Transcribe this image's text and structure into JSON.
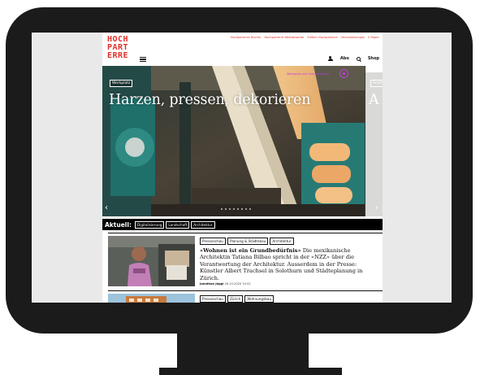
{
  "brand": {
    "logo_lines": [
      "HOCH",
      "PART",
      "ERRE"
    ],
    "accent": "#e3322c"
  },
  "topnav": [
    "Hochparterre Bücher",
    "Hochparterre Wettbewerbe",
    "Edition Hochparterre",
    "Veranstaltungen",
    "E-Paper"
  ],
  "utilnav": {
    "abo": "Abo",
    "shop": "Shop"
  },
  "hero": {
    "tag": "Werkplatz",
    "title": "Harzen, pressen, dekorieren",
    "sponsor_text": "Werkplatz mit Unterstützung",
    "next_tag": "Archit",
    "next_title": "A",
    "slide_count": 8
  },
  "aktuell": {
    "label": "Aktuell:",
    "chips": [
      "Digitalisierung",
      "Landschaft",
      "Architektur"
    ]
  },
  "articles": [
    {
      "chips": [
        "Presseschau",
        "Planung & Städtebau",
        "Architektur"
      ],
      "headline": "«Wohnen ist ein Grundbedürfnis»",
      "text": "Die mexikanische Architektin Tatiana Bilbao spricht in der «NZZ» über die Verantwortung der Architektur. Ausserdem in der Presse: Künstler Albert Trachsel in Solothurn und Städteplanung in Zürich.",
      "author": "Jonathan Jäggi",
      "date": "26.10.2020 10:52"
    },
    {
      "chips": [
        "Presseschau",
        "Zürich",
        "Wohnungsbau"
      ]
    }
  ]
}
